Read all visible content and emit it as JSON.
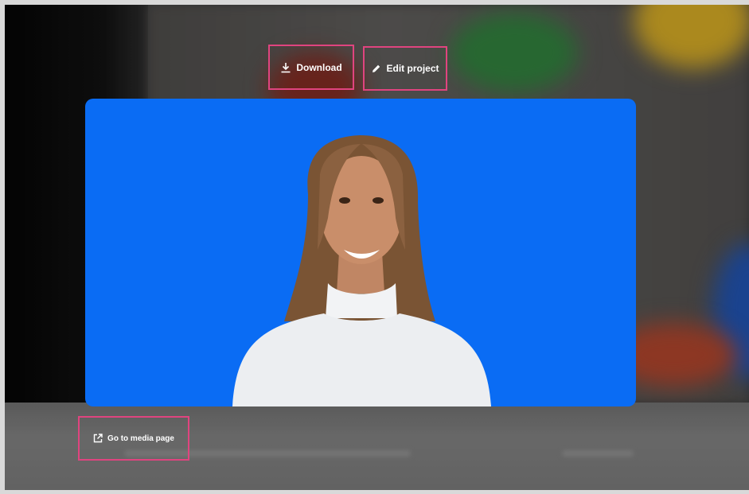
{
  "actions": {
    "download_label": "Download",
    "download_icon": "download-icon",
    "edit_label": "Edit project",
    "edit_icon": "pencil-icon"
  },
  "media_link": {
    "label": "Go to media page",
    "icon": "external-link-icon"
  },
  "colors": {
    "highlight": "#e0447f",
    "preview_background": "#0a6cf4"
  }
}
